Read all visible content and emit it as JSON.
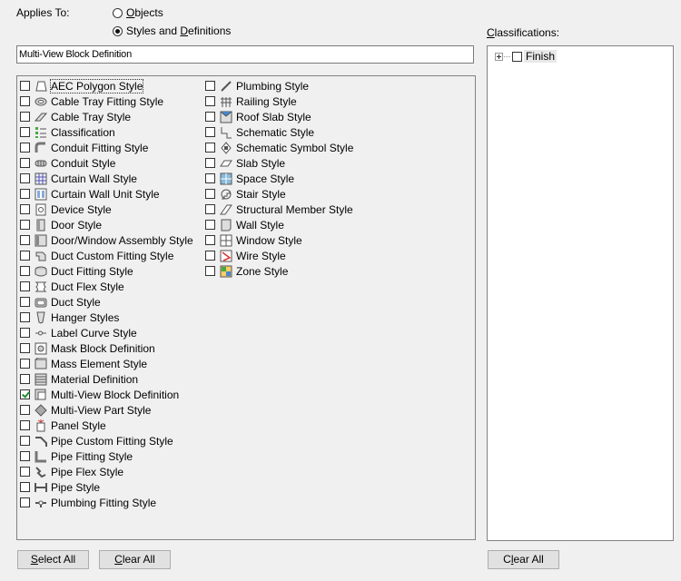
{
  "applies_to": {
    "label": "Applies To:",
    "options": [
      {
        "pre": "",
        "key": "O",
        "post": "bjects",
        "selected": false
      },
      {
        "pre": "Styles and ",
        "key": "D",
        "post": "efinitions",
        "selected": true
      }
    ]
  },
  "classifications": {
    "label_key": "C",
    "label_rest": "lassifications:",
    "tree": [
      {
        "label": "Finish",
        "checked": false,
        "expandable": true
      }
    ]
  },
  "name_field": {
    "value": "Multi-View Block Definition"
  },
  "styles_left": [
    {
      "label": "AEC Polygon Style",
      "icon": "aec-polygon-icon",
      "checked": false,
      "focused": true
    },
    {
      "label": "Cable Tray Fitting Style",
      "icon": "cable-tray-fitting-icon",
      "checked": false
    },
    {
      "label": "Cable Tray Style",
      "icon": "cable-tray-icon",
      "checked": false
    },
    {
      "label": "Classification",
      "icon": "classification-icon",
      "checked": false
    },
    {
      "label": "Conduit Fitting Style",
      "icon": "conduit-fitting-icon",
      "checked": false
    },
    {
      "label": "Conduit Style",
      "icon": "conduit-icon",
      "checked": false
    },
    {
      "label": "Curtain Wall Style",
      "icon": "curtain-wall-icon",
      "checked": false
    },
    {
      "label": "Curtain Wall Unit Style",
      "icon": "curtain-wall-unit-icon",
      "checked": false
    },
    {
      "label": "Device Style",
      "icon": "device-icon",
      "checked": false
    },
    {
      "label": "Door Style",
      "icon": "door-icon",
      "checked": false
    },
    {
      "label": "Door/Window Assembly Style",
      "icon": "door-window-assembly-icon",
      "checked": false
    },
    {
      "label": "Duct Custom Fitting Style",
      "icon": "duct-custom-fitting-icon",
      "checked": false
    },
    {
      "label": "Duct Fitting Style",
      "icon": "duct-fitting-icon",
      "checked": false
    },
    {
      "label": "Duct Flex Style",
      "icon": "duct-flex-icon",
      "checked": false
    },
    {
      "label": "Duct Style",
      "icon": "duct-icon",
      "checked": false
    },
    {
      "label": "Hanger Styles",
      "icon": "hanger-icon",
      "checked": false
    },
    {
      "label": "Label Curve Style",
      "icon": "label-curve-icon",
      "checked": false
    },
    {
      "label": "Mask Block Definition",
      "icon": "mask-block-icon",
      "checked": false
    },
    {
      "label": "Mass Element Style",
      "icon": "mass-element-icon",
      "checked": false
    },
    {
      "label": "Material Definition",
      "icon": "material-icon",
      "checked": false
    },
    {
      "label": "Multi-View Block Definition",
      "icon": "multi-view-block-icon",
      "checked": true
    },
    {
      "label": "Multi-View Part Style",
      "icon": "multi-view-part-icon",
      "checked": false
    },
    {
      "label": "Panel Style",
      "icon": "panel-icon",
      "checked": false
    },
    {
      "label": "Pipe Custom Fitting Style",
      "icon": "pipe-custom-fitting-icon",
      "checked": false
    },
    {
      "label": "Pipe Fitting Style",
      "icon": "pipe-fitting-icon",
      "checked": false
    },
    {
      "label": "Pipe Flex Style",
      "icon": "pipe-flex-icon",
      "checked": false
    },
    {
      "label": "Pipe Style",
      "icon": "pipe-icon",
      "checked": false
    },
    {
      "label": "Plumbing Fitting Style",
      "icon": "plumbing-fitting-icon",
      "checked": false
    }
  ],
  "styles_right": [
    {
      "label": "Plumbing Style",
      "icon": "plumbing-icon",
      "checked": false
    },
    {
      "label": "Railing Style",
      "icon": "railing-icon",
      "checked": false
    },
    {
      "label": "Roof Slab Style",
      "icon": "roof-slab-icon",
      "checked": false
    },
    {
      "label": "Schematic Style",
      "icon": "schematic-icon",
      "checked": false
    },
    {
      "label": "Schematic Symbol Style",
      "icon": "schematic-symbol-icon",
      "checked": false
    },
    {
      "label": "Slab Style",
      "icon": "slab-icon",
      "checked": false
    },
    {
      "label": "Space Style",
      "icon": "space-icon",
      "checked": false
    },
    {
      "label": "Stair Style",
      "icon": "stair-icon",
      "checked": false
    },
    {
      "label": "Structural Member Style",
      "icon": "structural-member-icon",
      "checked": false
    },
    {
      "label": "Wall Style",
      "icon": "wall-icon",
      "checked": false
    },
    {
      "label": "Window Style",
      "icon": "window-icon",
      "checked": false
    },
    {
      "label": "Wire Style",
      "icon": "wire-icon",
      "checked": false
    },
    {
      "label": "Zone Style",
      "icon": "zone-icon",
      "checked": false
    }
  ],
  "buttons": {
    "select_all": {
      "key": "S",
      "rest": "elect All"
    },
    "clear_all_left": {
      "key": "C",
      "rest": "lear All"
    },
    "clear_all_right": {
      "pre": "C",
      "key": "l",
      "rest": "ear All"
    }
  }
}
